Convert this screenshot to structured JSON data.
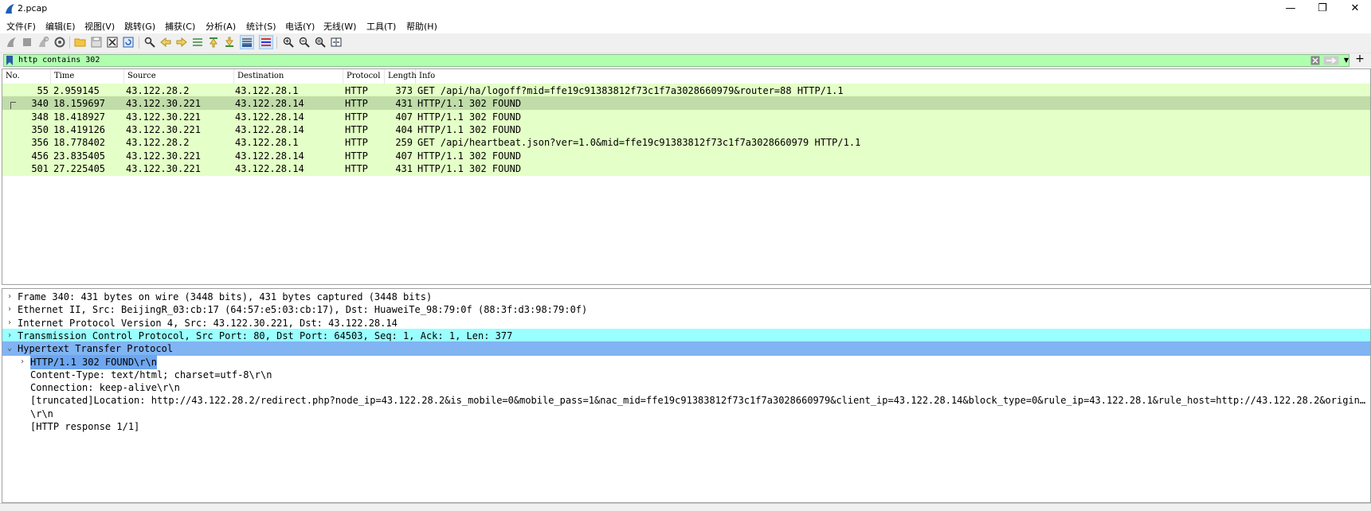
{
  "window": {
    "title": "2.pcap",
    "minimize": "—",
    "maximize": "❐",
    "close": "✕"
  },
  "menu": [
    "文件(F)",
    "编辑(E)",
    "视图(V)",
    "跳转(G)",
    "捕获(C)",
    "分析(A)",
    "统计(S)",
    "电话(Y)",
    "无线(W)",
    "工具(T)",
    "帮助(H)"
  ],
  "toolbar": {
    "icons": [
      "shark-start-icon",
      "stop-icon",
      "restart-icon",
      "options-gear-icon",
      "open-folder-icon",
      "save-icon",
      "close-file-icon",
      "reload-icon",
      "find-icon",
      "back-arrow-icon",
      "forward-arrow-icon",
      "go-to-packet-icon",
      "first-packet-icon",
      "last-packet-icon",
      "autoscroll-icon",
      "colorize-icon",
      "zoom-in-icon",
      "zoom-out-icon",
      "zoom-normal-icon",
      "resize-columns-icon"
    ],
    "active": [
      "autoscroll-icon",
      "colorize-icon"
    ]
  },
  "filter": {
    "value": "http contains 302"
  },
  "packet_list": {
    "columns": [
      "No.",
      "Time",
      "Source",
      "Destination",
      "Protocol",
      "Length",
      "Info"
    ],
    "rows": [
      {
        "no": "55",
        "time": "2.959145",
        "src": "43.122.28.2",
        "dst": "43.122.28.1",
        "proto": "HTTP",
        "len": "373",
        "info": "GET /api/ha/logoff?mid=ffe19c91383812f73c1f7a3028660979&router=88 HTTP/1.1"
      },
      {
        "no": "340",
        "time": "18.159697",
        "src": "43.122.30.221",
        "dst": "43.122.28.14",
        "proto": "HTTP",
        "len": "431",
        "info": "HTTP/1.1 302 FOUND",
        "selected": true
      },
      {
        "no": "348",
        "time": "18.418927",
        "src": "43.122.30.221",
        "dst": "43.122.28.14",
        "proto": "HTTP",
        "len": "407",
        "info": "HTTP/1.1 302 FOUND"
      },
      {
        "no": "350",
        "time": "18.419126",
        "src": "43.122.30.221",
        "dst": "43.122.28.14",
        "proto": "HTTP",
        "len": "404",
        "info": "HTTP/1.1 302 FOUND"
      },
      {
        "no": "356",
        "time": "18.778402",
        "src": "43.122.28.2",
        "dst": "43.122.28.1",
        "proto": "HTTP",
        "len": "259",
        "info": "GET /api/heartbeat.json?ver=1.0&mid=ffe19c91383812f73c1f7a3028660979 HTTP/1.1"
      },
      {
        "no": "456",
        "time": "23.835405",
        "src": "43.122.30.221",
        "dst": "43.122.28.14",
        "proto": "HTTP",
        "len": "407",
        "info": "HTTP/1.1 302 FOUND"
      },
      {
        "no": "501",
        "time": "27.225405",
        "src": "43.122.30.221",
        "dst": "43.122.28.14",
        "proto": "HTTP",
        "len": "431",
        "info": "HTTP/1.1 302 FOUND"
      }
    ],
    "row_color": "#e4ffc7",
    "selected_color": "#c0dca8"
  },
  "details": {
    "lines": [
      {
        "text": "Frame 340: 431 bytes on wire (3448 bits), 431 bytes captured (3448 bits)",
        "arrow": "›",
        "level": 0
      },
      {
        "text": "Ethernet II, Src: BeijingR_03:cb:17 (64:57:e5:03:cb:17), Dst: HuaweiTe_98:79:0f (88:3f:d3:98:79:0f)",
        "arrow": "›",
        "level": 0
      },
      {
        "text": "Internet Protocol Version 4, Src: 43.122.30.221, Dst: 43.122.28.14",
        "arrow": "›",
        "level": 0
      },
      {
        "text": "Transmission Control Protocol, Src Port: 80, Dst Port: 64503, Seq: 1, Ack: 1, Len: 377",
        "arrow": "›",
        "level": 0,
        "highlight": "cyan"
      },
      {
        "text": "Hypertext Transfer Protocol",
        "arrow": "⌄",
        "level": 0,
        "highlight": "blue"
      },
      {
        "text": "HTTP/1.1 302 FOUND\\r\\n",
        "arrow": "›",
        "level": 1,
        "selected": true
      },
      {
        "text": "Content-Type: text/html; charset=utf-8\\r\\n",
        "arrow": "",
        "level": 1
      },
      {
        "text": "Connection: keep-alive\\r\\n",
        "arrow": "",
        "level": 1
      },
      {
        "text": " [truncated]Location: http://43.122.28.2/redirect.php?node_ip=43.122.28.2&is_mobile=0&mobile_pass=1&nac_mid=ffe19c91383812f73c1f7a3028660979&client_ip=43.122.28.14&block_type=0&rule_ip=43.122.28.1&rule_host=http://43.122.28.2&origin…",
        "arrow": "",
        "level": 1
      },
      {
        "text": "\\r\\n",
        "arrow": "",
        "level": 1
      },
      {
        "text": "[HTTP response 1/1]",
        "arrow": "",
        "level": 1
      }
    ],
    "cyan": "#99ffff",
    "blue": "#80b4f3"
  }
}
